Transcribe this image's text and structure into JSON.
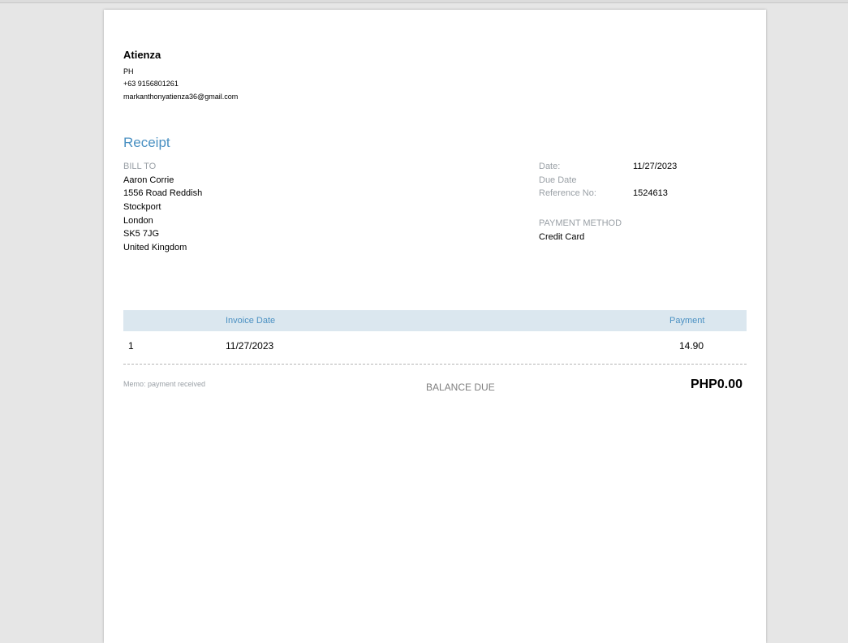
{
  "company": {
    "name": "Atienza",
    "country": "PH",
    "phone": "+63 9156801261",
    "email": "markanthonyatienza36@gmail.com"
  },
  "document": {
    "title": "Receipt"
  },
  "bill_to": {
    "label": "BILL TO",
    "lines": [
      "Aaron Corrie",
      "1556 Road Reddish",
      "Stockport",
      "London",
      "SK5 7JG",
      "United Kingdom"
    ]
  },
  "meta": {
    "date_label": "Date:",
    "date_value": "11/27/2023",
    "due_date_label": "Due Date",
    "due_date_value": "",
    "reference_label": "Reference No:",
    "reference_value": "1524613",
    "payment_method_label": "PAYMENT METHOD",
    "payment_method_value": "Credit Card"
  },
  "table": {
    "columns": [
      "",
      "Invoice Date",
      "Payment"
    ],
    "rows": [
      [
        "1",
        "11/27/2023",
        "14.90"
      ]
    ]
  },
  "footer": {
    "memo": "Memo: payment received",
    "balance_label": "BALANCE DUE",
    "balance_value": "PHP0.00"
  },
  "colors": {
    "accent": "#4a90c2",
    "table_header_bg": "#dbe7ef",
    "muted_text": "#9aa0a6",
    "background": "#e6e6e6"
  }
}
